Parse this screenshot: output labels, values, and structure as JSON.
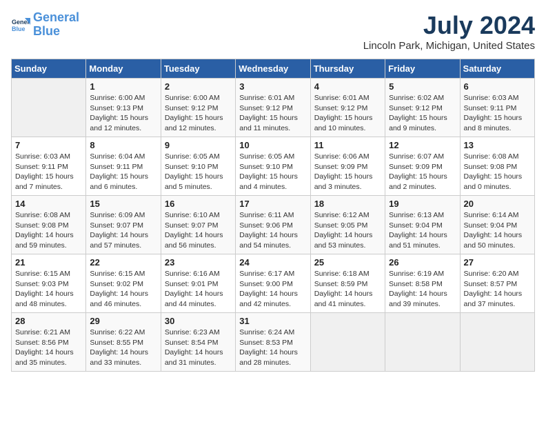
{
  "header": {
    "logo_line1": "General",
    "logo_line2": "Blue",
    "month_year": "July 2024",
    "location": "Lincoln Park, Michigan, United States"
  },
  "days_of_week": [
    "Sunday",
    "Monday",
    "Tuesday",
    "Wednesday",
    "Thursday",
    "Friday",
    "Saturday"
  ],
  "weeks": [
    [
      {
        "day": "",
        "info": ""
      },
      {
        "day": "1",
        "info": "Sunrise: 6:00 AM\nSunset: 9:13 PM\nDaylight: 15 hours\nand 12 minutes."
      },
      {
        "day": "2",
        "info": "Sunrise: 6:00 AM\nSunset: 9:12 PM\nDaylight: 15 hours\nand 12 minutes."
      },
      {
        "day": "3",
        "info": "Sunrise: 6:01 AM\nSunset: 9:12 PM\nDaylight: 15 hours\nand 11 minutes."
      },
      {
        "day": "4",
        "info": "Sunrise: 6:01 AM\nSunset: 9:12 PM\nDaylight: 15 hours\nand 10 minutes."
      },
      {
        "day": "5",
        "info": "Sunrise: 6:02 AM\nSunset: 9:12 PM\nDaylight: 15 hours\nand 9 minutes."
      },
      {
        "day": "6",
        "info": "Sunrise: 6:03 AM\nSunset: 9:11 PM\nDaylight: 15 hours\nand 8 minutes."
      }
    ],
    [
      {
        "day": "7",
        "info": "Sunrise: 6:03 AM\nSunset: 9:11 PM\nDaylight: 15 hours\nand 7 minutes."
      },
      {
        "day": "8",
        "info": "Sunrise: 6:04 AM\nSunset: 9:11 PM\nDaylight: 15 hours\nand 6 minutes."
      },
      {
        "day": "9",
        "info": "Sunrise: 6:05 AM\nSunset: 9:10 PM\nDaylight: 15 hours\nand 5 minutes."
      },
      {
        "day": "10",
        "info": "Sunrise: 6:05 AM\nSunset: 9:10 PM\nDaylight: 15 hours\nand 4 minutes."
      },
      {
        "day": "11",
        "info": "Sunrise: 6:06 AM\nSunset: 9:09 PM\nDaylight: 15 hours\nand 3 minutes."
      },
      {
        "day": "12",
        "info": "Sunrise: 6:07 AM\nSunset: 9:09 PM\nDaylight: 15 hours\nand 2 minutes."
      },
      {
        "day": "13",
        "info": "Sunrise: 6:08 AM\nSunset: 9:08 PM\nDaylight: 15 hours\nand 0 minutes."
      }
    ],
    [
      {
        "day": "14",
        "info": "Sunrise: 6:08 AM\nSunset: 9:08 PM\nDaylight: 14 hours\nand 59 minutes."
      },
      {
        "day": "15",
        "info": "Sunrise: 6:09 AM\nSunset: 9:07 PM\nDaylight: 14 hours\nand 57 minutes."
      },
      {
        "day": "16",
        "info": "Sunrise: 6:10 AM\nSunset: 9:07 PM\nDaylight: 14 hours\nand 56 minutes."
      },
      {
        "day": "17",
        "info": "Sunrise: 6:11 AM\nSunset: 9:06 PM\nDaylight: 14 hours\nand 54 minutes."
      },
      {
        "day": "18",
        "info": "Sunrise: 6:12 AM\nSunset: 9:05 PM\nDaylight: 14 hours\nand 53 minutes."
      },
      {
        "day": "19",
        "info": "Sunrise: 6:13 AM\nSunset: 9:04 PM\nDaylight: 14 hours\nand 51 minutes."
      },
      {
        "day": "20",
        "info": "Sunrise: 6:14 AM\nSunset: 9:04 PM\nDaylight: 14 hours\nand 50 minutes."
      }
    ],
    [
      {
        "day": "21",
        "info": "Sunrise: 6:15 AM\nSunset: 9:03 PM\nDaylight: 14 hours\nand 48 minutes."
      },
      {
        "day": "22",
        "info": "Sunrise: 6:15 AM\nSunset: 9:02 PM\nDaylight: 14 hours\nand 46 minutes."
      },
      {
        "day": "23",
        "info": "Sunrise: 6:16 AM\nSunset: 9:01 PM\nDaylight: 14 hours\nand 44 minutes."
      },
      {
        "day": "24",
        "info": "Sunrise: 6:17 AM\nSunset: 9:00 PM\nDaylight: 14 hours\nand 42 minutes."
      },
      {
        "day": "25",
        "info": "Sunrise: 6:18 AM\nSunset: 8:59 PM\nDaylight: 14 hours\nand 41 minutes."
      },
      {
        "day": "26",
        "info": "Sunrise: 6:19 AM\nSunset: 8:58 PM\nDaylight: 14 hours\nand 39 minutes."
      },
      {
        "day": "27",
        "info": "Sunrise: 6:20 AM\nSunset: 8:57 PM\nDaylight: 14 hours\nand 37 minutes."
      }
    ],
    [
      {
        "day": "28",
        "info": "Sunrise: 6:21 AM\nSunset: 8:56 PM\nDaylight: 14 hours\nand 35 minutes."
      },
      {
        "day": "29",
        "info": "Sunrise: 6:22 AM\nSunset: 8:55 PM\nDaylight: 14 hours\nand 33 minutes."
      },
      {
        "day": "30",
        "info": "Sunrise: 6:23 AM\nSunset: 8:54 PM\nDaylight: 14 hours\nand 31 minutes."
      },
      {
        "day": "31",
        "info": "Sunrise: 6:24 AM\nSunset: 8:53 PM\nDaylight: 14 hours\nand 28 minutes."
      },
      {
        "day": "",
        "info": ""
      },
      {
        "day": "",
        "info": ""
      },
      {
        "day": "",
        "info": ""
      }
    ]
  ]
}
